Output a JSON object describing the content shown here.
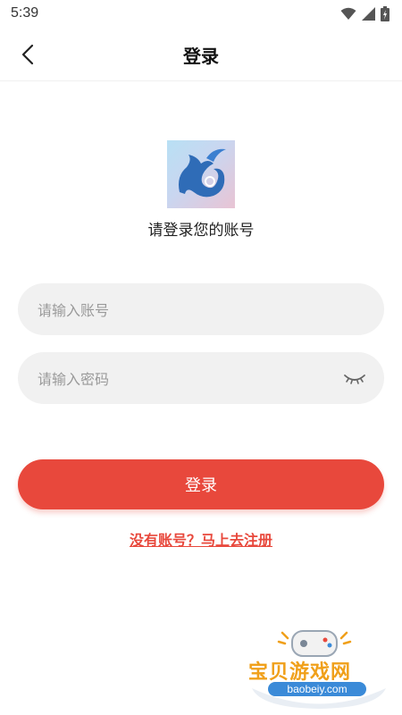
{
  "status_bar": {
    "time": "5:39"
  },
  "nav": {
    "title": "登录"
  },
  "main": {
    "subtitle": "请登录您的账号",
    "account_placeholder": "请输入账号",
    "account_value": "",
    "password_placeholder": "请输入密码",
    "password_value": "",
    "login_label": "登录",
    "register_link": "没有账号？马上去注册"
  },
  "watermark": {
    "text": "宝贝游戏网",
    "url": "baobeiy.com"
  },
  "colors": {
    "accent": "#e8483c",
    "field_bg": "#f1f1f1",
    "watermark_orange": "#f0a01a",
    "watermark_blue": "#3a8ad8"
  },
  "icons": {
    "back": "chevron-left-icon",
    "wifi": "wifi-icon",
    "signal": "signal-icon",
    "battery": "battery-icon",
    "eye": "eye-closed-icon",
    "logo": "app-logo"
  }
}
